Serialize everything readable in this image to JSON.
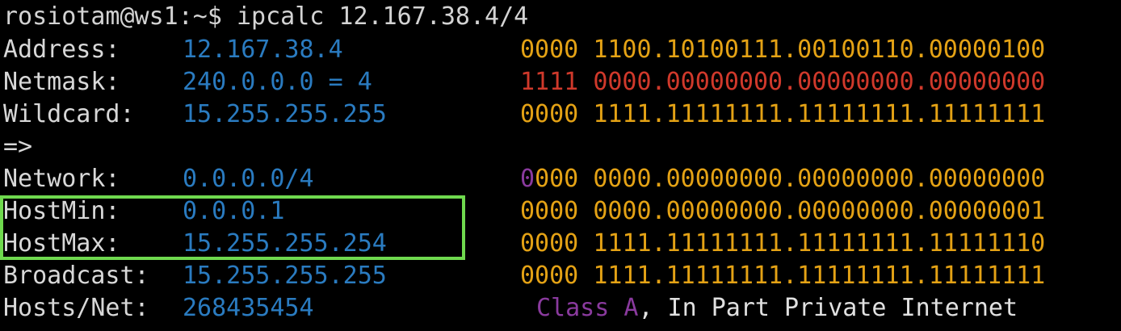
{
  "terminal": {
    "prompt": "rosiotam@ws1:~$ ipcalc 12.167.38.4/4",
    "colors": {
      "background": "#000000",
      "label": "#d8d8d8",
      "value": "#2a7bc0",
      "bits": "#e4a215",
      "netmask_bits": "#d0392b",
      "class_accent": "#8a3a9e",
      "highlight_border": "#6fd94e"
    },
    "rows": {
      "address": {
        "label": "Address:",
        "value": "12.167.38.4",
        "bits_head": "0000",
        "bits_tail": "1100.10100111.00100110.00000100"
      },
      "netmask": {
        "label": "Netmask:",
        "value": "240.0.0.0 = 4",
        "bits_head": "1111",
        "bits_tail": "0000.00000000.00000000.00000000"
      },
      "wildcard": {
        "label": "Wildcard:",
        "value": "15.255.255.255",
        "bits_head": "0000",
        "bits_tail": "1111.11111111.11111111.11111111"
      },
      "arrow": "=>",
      "network": {
        "label": "Network:",
        "value": "0.0.0.0/4",
        "bits_first": "0",
        "bits_rest": "000",
        "bits_tail": "0000.00000000.00000000.00000000"
      },
      "hostmin": {
        "label": "HostMin:",
        "value": "0.0.0.1",
        "bits_head": "0000",
        "bits_tail": "0000.00000000.00000000.00000001"
      },
      "hostmax": {
        "label": "HostMax:",
        "value": "15.255.255.254",
        "bits_head": "0000",
        "bits_tail": "1111.11111111.11111111.11111110"
      },
      "broadcast": {
        "label": "Broadcast:",
        "value": "15.255.255.255",
        "bits_head": "0000",
        "bits_tail": "1111.11111111.11111111.11111111"
      },
      "hosts": {
        "label": "Hosts/Net:",
        "value": "268435454",
        "class_label": "Class A",
        "class_rest": ", In Part Private Internet"
      }
    }
  }
}
